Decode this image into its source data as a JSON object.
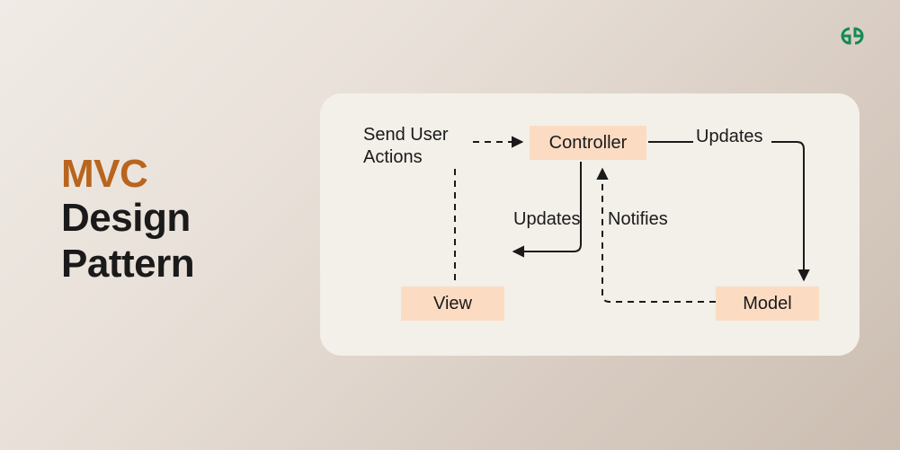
{
  "title": {
    "highlight": "MVC",
    "line1": "Design",
    "line2": "Pattern"
  },
  "diagram": {
    "nodes": {
      "controller": "Controller",
      "view": "View",
      "model": "Model"
    },
    "labels": {
      "send_user_actions": "Send User Actions",
      "updates_controller_to_view": "Updates",
      "notifies": "Notifies",
      "updates_controller_to_model": "Updates"
    }
  },
  "logo": {
    "name": "geeksforgeeks"
  }
}
